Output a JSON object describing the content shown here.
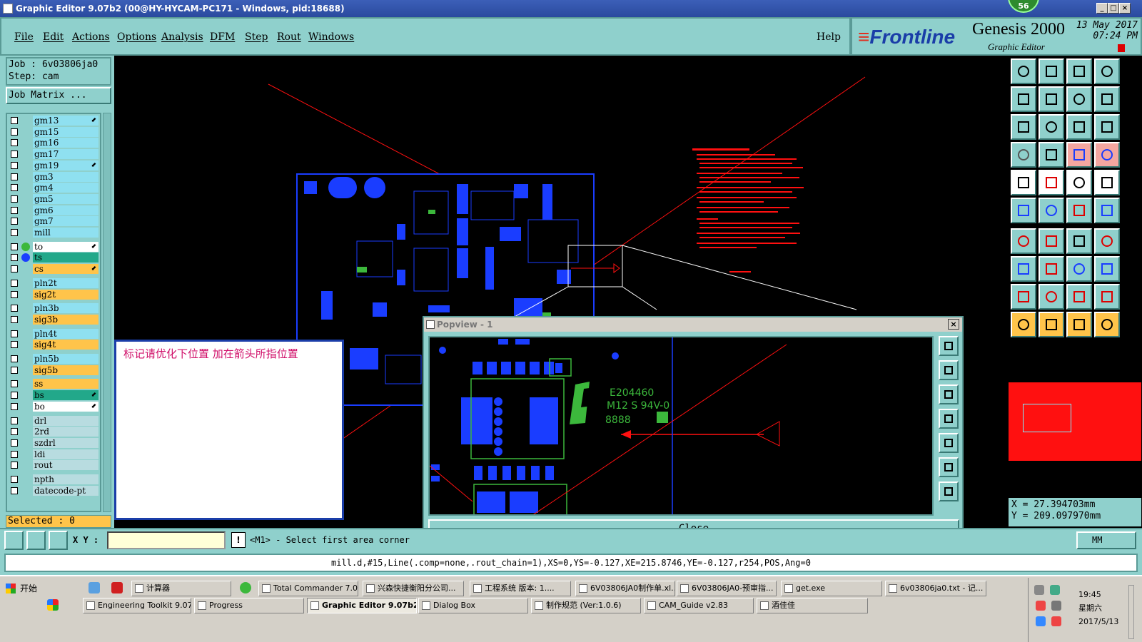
{
  "window": {
    "title": "Graphic Editor 9.07b2 (00@HY-HYCAM-PC171 - Windows, pid:18688)",
    "badge": "56"
  },
  "menu": [
    "File",
    "Edit",
    "Actions",
    "Options",
    "Analysis",
    "DFM",
    "Step",
    "Rout",
    "Windows"
  ],
  "help": "Help",
  "brand": {
    "logo": "Frontline",
    "product": "Genesis 2000",
    "subtitle": "Graphic Editor",
    "date": "13 May 2017",
    "time": "07:24 PM"
  },
  "job": {
    "job_label": "Job  : 6v03806ja0",
    "step_label": "Step: cam",
    "matrix_button": "Job Matrix ..."
  },
  "layers": [
    {
      "name": "gm13",
      "color": "#8fe0f0",
      "flag": "⬋"
    },
    {
      "name": "gm15",
      "color": "#8fe0f0",
      "flag": ""
    },
    {
      "name": "gm16",
      "color": "#8fe0f0",
      "flag": ""
    },
    {
      "name": "gm17",
      "color": "#8fe0f0",
      "flag": ""
    },
    {
      "name": "gm19",
      "color": "#8fe0f0",
      "flag": "⬋"
    },
    {
      "name": "gm3",
      "color": "#8fe0f0",
      "flag": ""
    },
    {
      "name": "gm4",
      "color": "#8fe0f0",
      "flag": ""
    },
    {
      "name": "gm5",
      "color": "#8fe0f0",
      "flag": ""
    },
    {
      "name": "gm6",
      "color": "#8fe0f0",
      "flag": ""
    },
    {
      "name": "gm7",
      "color": "#8fe0f0",
      "flag": ""
    },
    {
      "name": "mill",
      "color": "#8fe0f0",
      "flag": ""
    },
    {
      "name": "to",
      "color": "#ffffff",
      "flag": "⬋",
      "dot": "#3cb83c"
    },
    {
      "name": "ts",
      "color": "#22a88a",
      "flag": "",
      "dot": "#1a3dff"
    },
    {
      "name": "cs",
      "color": "#ffc44a",
      "flag": "⬋"
    },
    {
      "name": "pln2t",
      "color": "#8fe0f0",
      "flag": ""
    },
    {
      "name": "sig2t",
      "color": "#ffc44a",
      "flag": ""
    },
    {
      "name": "pln3b",
      "color": "#8fe0f0",
      "flag": ""
    },
    {
      "name": "sig3b",
      "color": "#ffc44a",
      "flag": ""
    },
    {
      "name": "pln4t",
      "color": "#8fe0f0",
      "flag": ""
    },
    {
      "name": "sig4t",
      "color": "#ffc44a",
      "flag": ""
    },
    {
      "name": "pln5b",
      "color": "#8fe0f0",
      "flag": ""
    },
    {
      "name": "sig5b",
      "color": "#ffc44a",
      "flag": ""
    },
    {
      "name": "ss",
      "color": "#ffc44a",
      "flag": ""
    },
    {
      "name": "bs",
      "color": "#22a88a",
      "flag": "⬋"
    },
    {
      "name": "bo",
      "color": "#ffffff",
      "flag": "⬋"
    },
    {
      "name": "drl",
      "color": "#b8dce0",
      "flag": ""
    },
    {
      "name": "2rd",
      "color": "#b8dce0",
      "flag": ""
    },
    {
      "name": "szdrl",
      "color": "#b8dce0",
      "flag": ""
    },
    {
      "name": "ldi",
      "color": "#b8dce0",
      "flag": ""
    },
    {
      "name": "rout",
      "color": "#b8dce0",
      "flag": ""
    },
    {
      "name": "npth",
      "color": "#b8dce0",
      "flag": ""
    },
    {
      "name": "datecode-pt",
      "color": "#b8dce0",
      "flag": ""
    }
  ],
  "selected": "Selected : 0",
  "note": "标记请优化下位置   加在箭头所指位置",
  "popview": {
    "title": "Popview - 1",
    "close_label": "Close",
    "ul_line1": "E204460",
    "ul_line2": "M12 S 94V-0",
    "ul_line3": "8888"
  },
  "coords": {
    "x": "X  =  27.394703mm",
    "y": "Y  = 209.097970mm"
  },
  "command": {
    "xy_label": "X Y :",
    "xy_value": "",
    "prompt": "<M1> - Select first area corner",
    "units": "MM"
  },
  "status": "mill.d,#15,Line(.comp=none,.rout_chain=1),XS=0,YS=-0.127,XE=215.8746,YE=-0.127,r254,POS,Ang=0",
  "taskbar": {
    "start": "开始",
    "row1": [
      "计算器",
      "Total Commander 7.0 ...",
      "兴森快捷衡阳分公司...",
      "工程系统  版本: 1....",
      "6V03806JA0制作单.xl...",
      "6V03806JA0-预审指...",
      "get.exe",
      "6v03806ja0.txt - 记..."
    ],
    "row2": [
      "Engineering Toolkit 9.07...",
      "Progress",
      "Graphic Editor 9.07b2 ...",
      "Dialog Box",
      "制作规范 (Ver:1.0.6)",
      "CAM_Guide v2.83",
      "酒佳佳"
    ],
    "time": "19:45",
    "weekday": "星期六",
    "date": "2017/5/13"
  },
  "colors": {
    "panel": "#8fd0cc",
    "pcb_blue": "#1a3dff",
    "silk_green": "#3cb83c",
    "drc_red": "#ff1010"
  }
}
